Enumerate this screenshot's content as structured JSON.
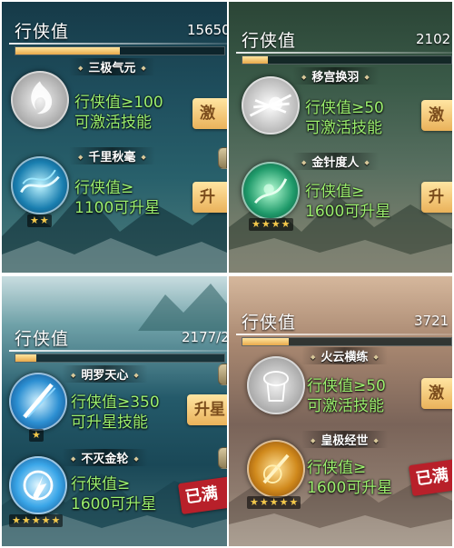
{
  "panels": [
    {
      "header": {
        "title": "行侠值",
        "value": "15650",
        "progress": 0.5
      },
      "skills": [
        {
          "name": "三极气元",
          "requirement_line1": "行侠值≥100",
          "requirement_line2": "可激活技能",
          "button": "激",
          "stars": 0,
          "icon": "qi-swirl-icon"
        },
        {
          "name": "千里秋毫",
          "requirement_line1": "行侠值≥",
          "requirement_line2": "1100可升星",
          "button": "升",
          "stars": 2,
          "icon": "water-flow-icon"
        }
      ]
    },
    {
      "header": {
        "title": "行侠值",
        "value": "2102",
        "progress": 0.12
      },
      "skills": [
        {
          "name": "移宫换羽",
          "requirement_line1": "行侠值≥50",
          "requirement_line2": "可激活技能",
          "button": "激",
          "stars": 0,
          "icon": "feather-burst-icon"
        },
        {
          "name": "金针度人",
          "requirement_line1": "行侠值≥",
          "requirement_line2": "1600可升星",
          "button": "升",
          "stars": 4,
          "icon": "green-needle-icon"
        }
      ]
    },
    {
      "header": {
        "title": "行侠值",
        "value": "2177/2",
        "progress": 0.1
      },
      "skills": [
        {
          "name": "明罗天心",
          "requirement_line1": "行侠值≥350",
          "requirement_line2": "可升星技能",
          "button": "升星",
          "stars": 1,
          "icon": "blue-blade-icon"
        },
        {
          "name": "不灭金轮",
          "requirement_line1": "行侠值≥",
          "requirement_line2": "1600可升星",
          "badge": "已满",
          "stars": 5,
          "icon": "blue-wheel-icon"
        }
      ]
    },
    {
      "header": {
        "title": "行侠值",
        "value": "3721",
        "progress": 0.22
      },
      "skills": [
        {
          "name": "火云横练",
          "requirement_line1": "行侠值≥50",
          "requirement_line2": "可激活技能",
          "button": "激",
          "stars": 0,
          "icon": "fire-cloud-icon"
        },
        {
          "name": "皇极经世",
          "requirement_line1": "行侠值≥",
          "requirement_line2": "1600可升星",
          "badge": "已满",
          "stars": 5,
          "icon": "golden-sword-icon"
        }
      ]
    }
  ],
  "colors": {
    "requirement_text": "#9cf06e",
    "star": "#f3c84b",
    "button_gold": "#eab25a",
    "maxed_seal": "#b8202a"
  }
}
